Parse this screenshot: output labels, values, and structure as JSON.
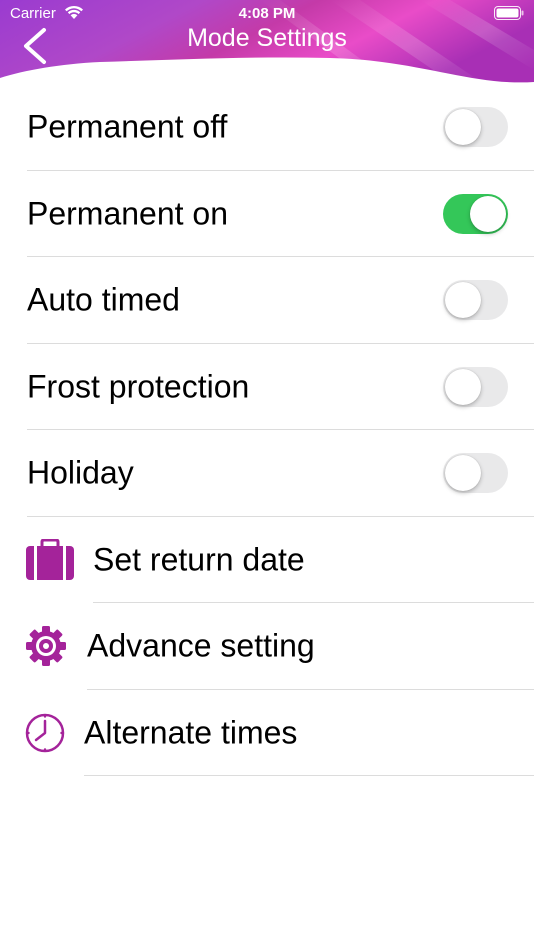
{
  "status": {
    "carrier": "Carrier",
    "time": "4:08 PM"
  },
  "header": {
    "title": "Mode Settings",
    "back_icon": "chevron-left-icon"
  },
  "colors": {
    "accent": "#a4239a",
    "toggle_on": "#34c759",
    "toggle_off": "#e9e9ea"
  },
  "toggles": [
    {
      "label": "Permanent off",
      "on": false
    },
    {
      "label": "Permanent on",
      "on": true
    },
    {
      "label": "Auto timed",
      "on": false
    },
    {
      "label": "Frost protection",
      "on": false
    },
    {
      "label": "Holiday",
      "on": false
    }
  ],
  "actions": [
    {
      "label": "Set return date",
      "icon": "suitcase-icon"
    },
    {
      "label": "Advance setting",
      "icon": "gear-icon"
    },
    {
      "label": "Alternate times",
      "icon": "clock-icon"
    }
  ]
}
